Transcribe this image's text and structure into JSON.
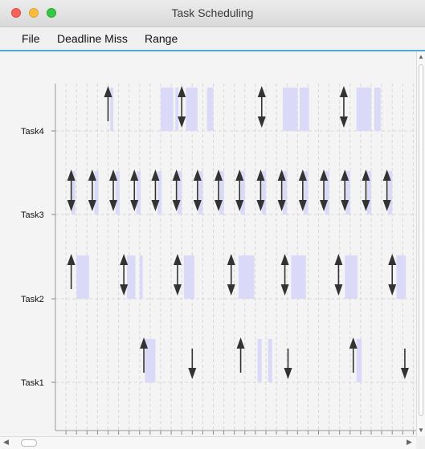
{
  "window": {
    "title": "Task Scheduling"
  },
  "menu": {
    "items": [
      "File",
      "Deadline Miss",
      "Range"
    ]
  },
  "chart_data": {
    "type": "gantt",
    "tasks": [
      "Task4",
      "Task3",
      "Task2",
      "Task1"
    ],
    "x_range": [
      0,
      34
    ],
    "grid": true,
    "execution_color": "#dadaf8",
    "arrow_color": "#333333",
    "rows": [
      {
        "task": "Task4",
        "blocks": [
          [
            5.2,
            5.5
          ],
          [
            10,
            11.2
          ],
          [
            11.4,
            11.7
          ],
          [
            12.4,
            13.5
          ],
          [
            14.4,
            15
          ],
          [
            21.6,
            23
          ],
          [
            23.2,
            24.1
          ],
          [
            28.6,
            30
          ],
          [
            30.3,
            30.9
          ]
        ],
        "releases": [
          5.0
        ],
        "deadline_releases": [
          12.0,
          19.6,
          27.4
        ],
        "deadlines": []
      },
      {
        "task": "Task3",
        "blocks": [
          [
            1.5,
            1.9
          ],
          [
            3.7,
            4.1
          ],
          [
            5.7,
            6.1
          ],
          [
            7.7,
            8.1
          ],
          [
            9.7,
            10.1
          ],
          [
            11.6,
            12
          ],
          [
            13.6,
            14
          ],
          [
            15.6,
            16
          ],
          [
            17.6,
            18
          ],
          [
            19.6,
            20
          ],
          [
            21.6,
            22
          ],
          [
            23.6,
            24
          ],
          [
            25.6,
            26
          ],
          [
            27.6,
            28
          ],
          [
            29.6,
            30
          ],
          [
            31.6,
            32
          ]
        ],
        "releases": [],
        "deadline_releases": [
          1.5,
          3.5,
          5.5,
          7.5,
          9.5,
          11.5,
          13.5,
          15.5,
          17.5,
          19.5,
          21.5,
          23.5,
          25.5,
          27.5,
          29.5,
          31.5
        ],
        "deadlines": []
      },
      {
        "task": "Task2",
        "blocks": [
          [
            2.0,
            3.2
          ],
          [
            6.8,
            7.6
          ],
          [
            8.0,
            8.3
          ],
          [
            12.2,
            13.2
          ],
          [
            17.4,
            18.9
          ],
          [
            22.4,
            23.8
          ],
          [
            27.5,
            28.7
          ],
          [
            32.4,
            33.3
          ]
        ],
        "releases": [
          1.5
        ],
        "deadline_releases": [
          6.5,
          11.6,
          16.7,
          21.8,
          26.9,
          32.0
        ],
        "deadlines": []
      },
      {
        "task": "Task1",
        "blocks": [
          [
            8.5,
            9.5
          ],
          [
            19.2,
            19.6
          ],
          [
            20.2,
            20.6
          ],
          [
            28.6,
            29.1
          ]
        ],
        "releases": [
          8.4,
          17.6,
          28.3
        ],
        "deadline_releases": [],
        "deadlines": [
          13.0,
          22.1,
          33.2
        ]
      }
    ]
  }
}
